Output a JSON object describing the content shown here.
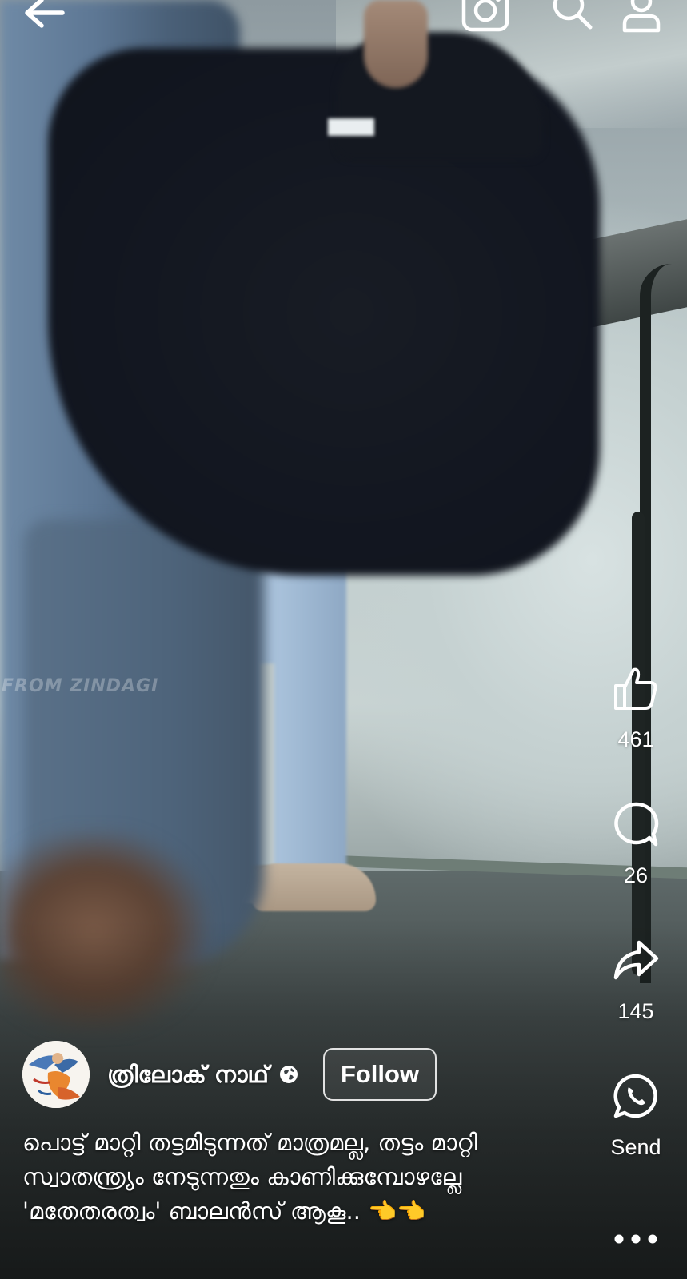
{
  "video": {
    "watermark": "FROM ZINDAGI"
  },
  "top_bar": {
    "back_icon": "arrow-left-icon",
    "camera_icon": "instagram-camera-icon",
    "search_icon": "search-icon",
    "profile_icon": "person-icon"
  },
  "actions": {
    "like_count": "461",
    "comment_count": "26",
    "share_count": "145",
    "send_label": "Send",
    "more_icon": "more-horizontal-icon"
  },
  "author": {
    "name": "ത്രിലോക് നാഥ്",
    "visibility_icon": "globe-icon",
    "follow_label": "Follow"
  },
  "caption": {
    "text": "പൊട്ട് മാറ്റി തട്ടമിടുന്നത് മാത്രമല്ല, തട്ടം മാറ്റി സ്വാതന്ത്ര്യം നേടുന്നതും കാണിക്കുമ്പോഴല്ലേ 'മതേതരത്വം' ബാലൻസ് ആകൂ.. 👈👈"
  },
  "colors": {
    "text": "#ffffff",
    "follow_border": "#ffffff"
  }
}
